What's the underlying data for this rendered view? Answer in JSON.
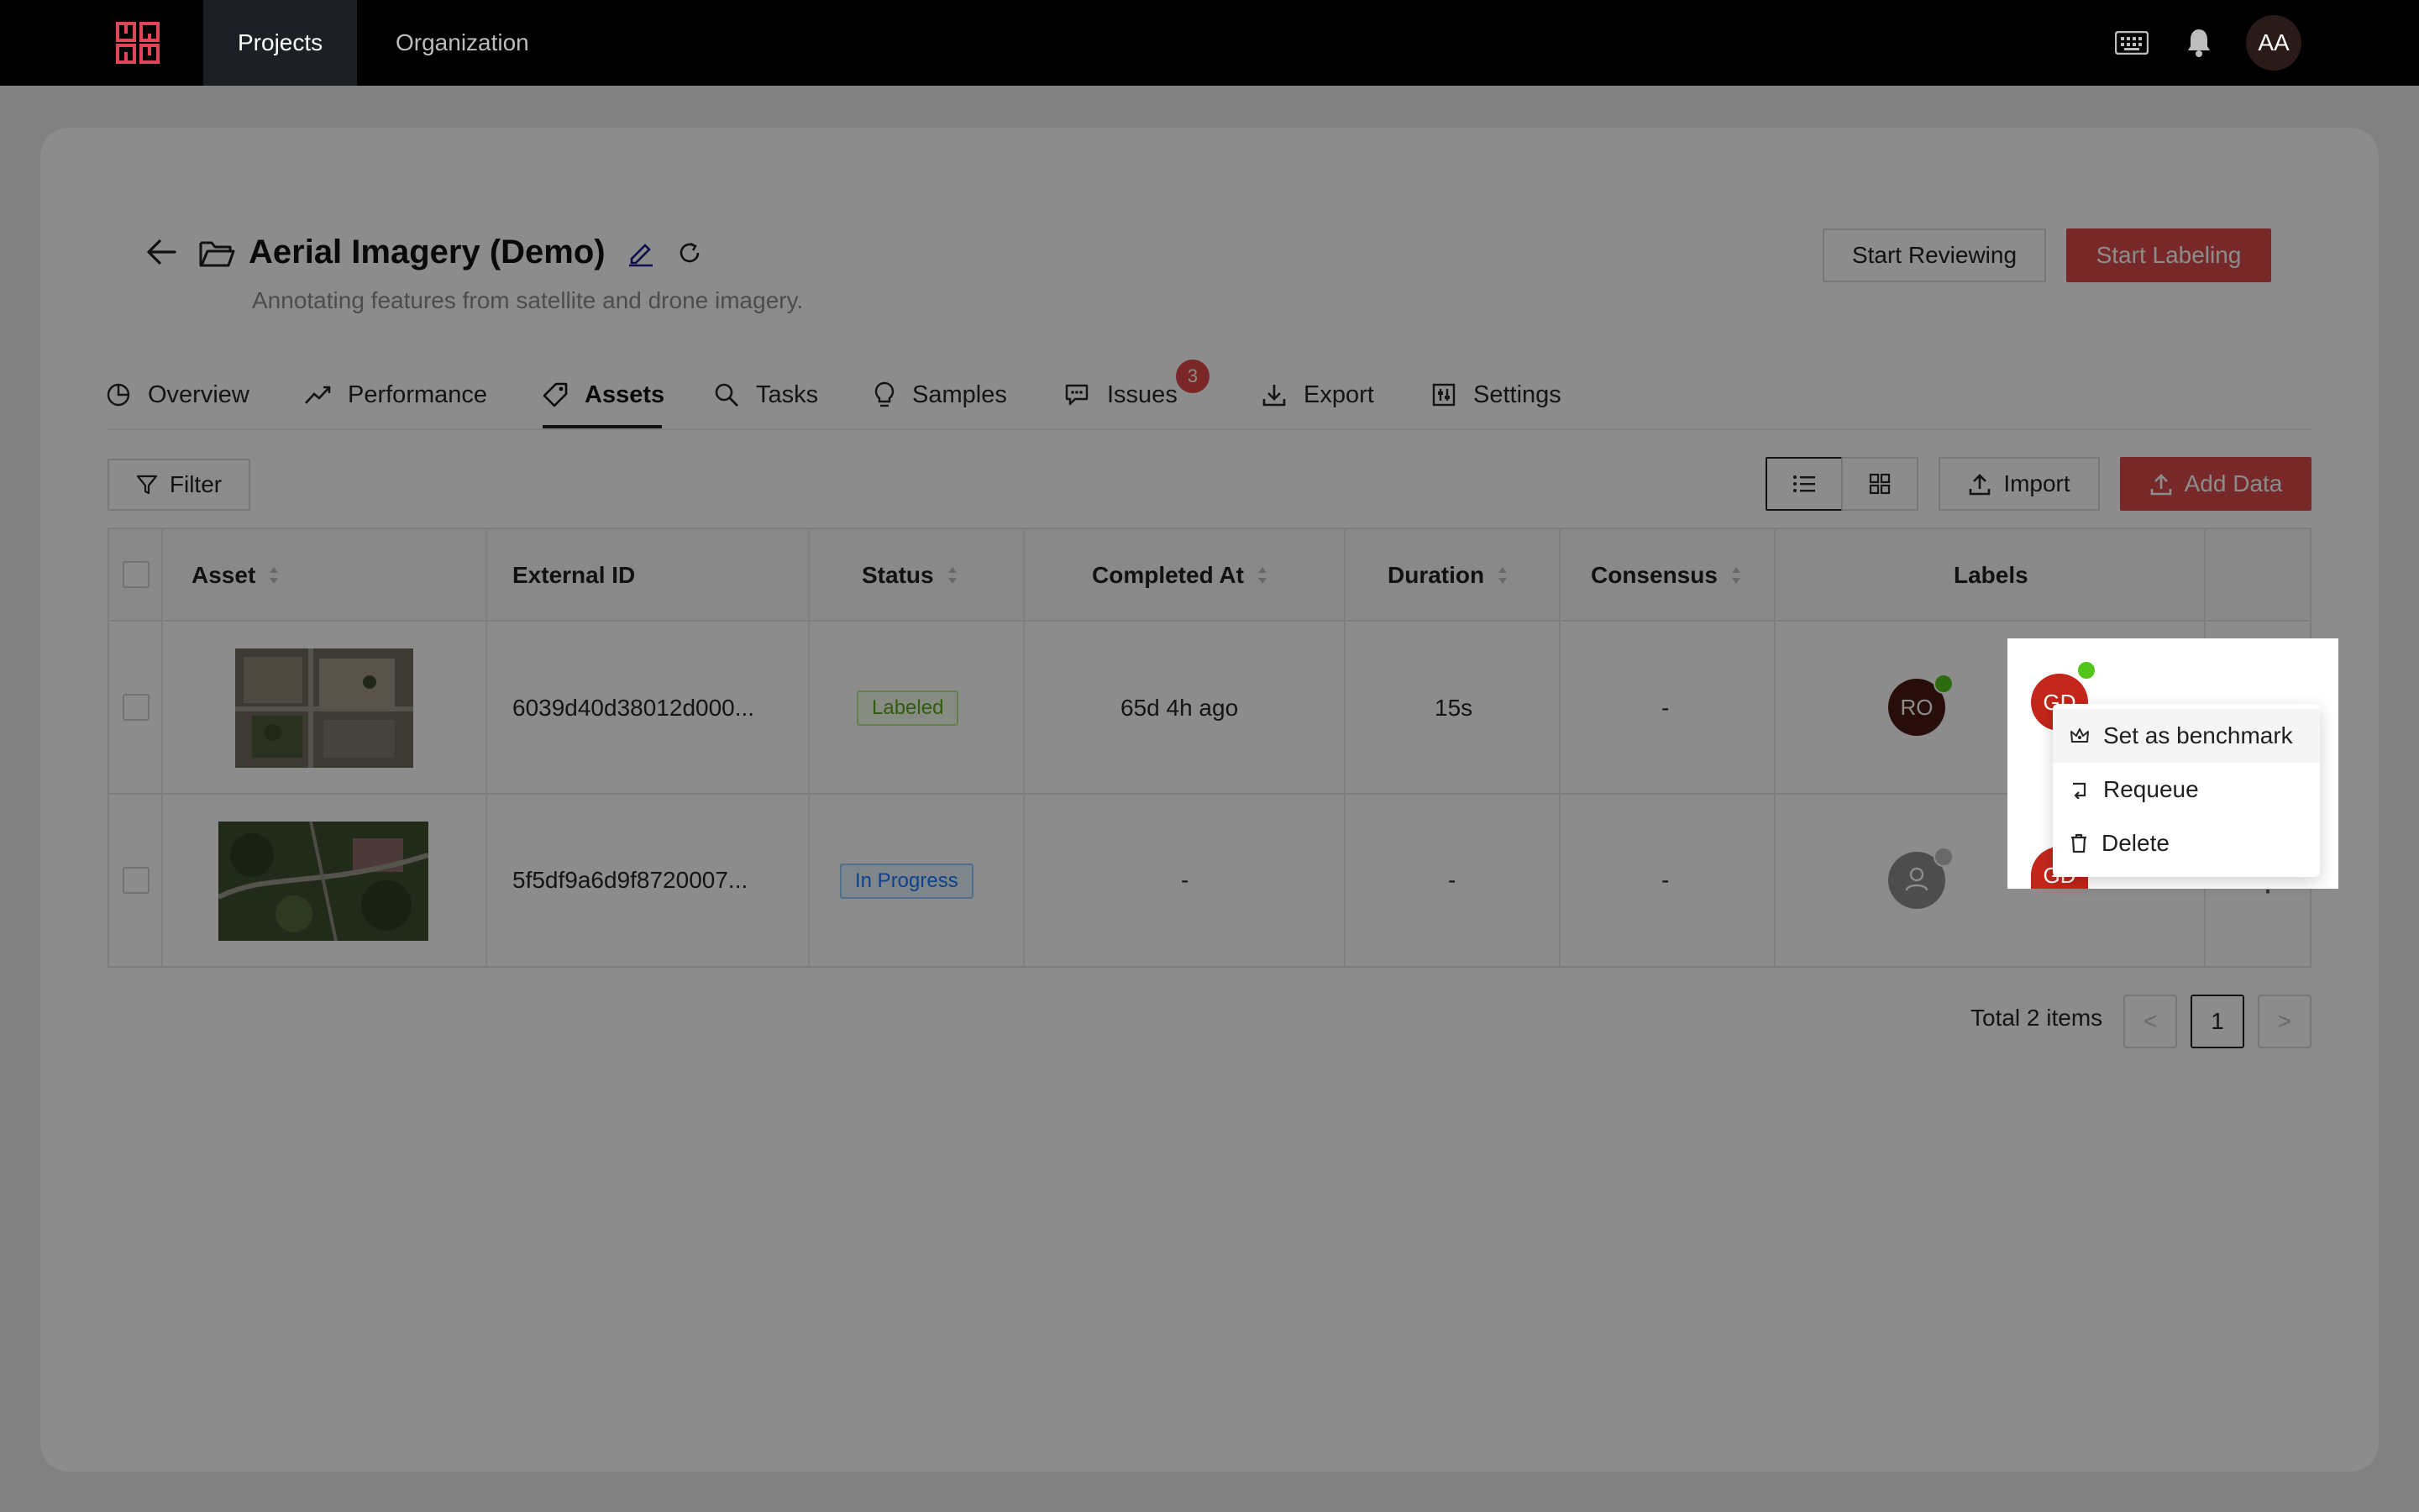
{
  "nav": {
    "tabs": [
      {
        "label": "Projects"
      },
      {
        "label": "Organization"
      }
    ],
    "user_initials": "AA",
    "icons": [
      "app-logo",
      "keyboard-icon",
      "bell-icon"
    ]
  },
  "project": {
    "title": "Aerial Imagery (Demo)",
    "description": "Annotating features from satellite and drone imagery.",
    "start_reviewing_label": "Start Reviewing",
    "start_labeling_label": "Start Labeling"
  },
  "tabs": [
    {
      "label": "Overview",
      "icon": "pie-chart-icon"
    },
    {
      "label": "Performance",
      "icon": "trend-line-icon"
    },
    {
      "label": "Assets",
      "icon": "tag-icon"
    },
    {
      "label": "Tasks",
      "icon": "search-icon"
    },
    {
      "label": "Samples",
      "icon": "bulb-icon"
    },
    {
      "label": "Issues",
      "icon": "chat-icon"
    },
    {
      "label": "Export",
      "icon": "download-icon"
    },
    {
      "label": "Settings",
      "icon": "sliders-icon"
    }
  ],
  "active_tab": "Assets",
  "issues_count": "3",
  "toolbar": {
    "filter_label": "Filter",
    "import_label": "Import",
    "add_data_label": "Add Data"
  },
  "table": {
    "columns": [
      "Asset",
      "External ID",
      "Status",
      "Completed At",
      "Duration",
      "Consensus",
      "Labels"
    ],
    "rows": [
      {
        "external_id": "6039d40d38012d000...",
        "status": "Labeled",
        "completed_at": "65d 4h ago",
        "duration": "15s",
        "consensus": "-",
        "labeler_initials": "RO",
        "reviewer_initials": "GD"
      },
      {
        "external_id": "5f5df9a6d9f8720007...",
        "status": "In Progress",
        "completed_at": "-",
        "duration": "-",
        "consensus": "-",
        "labeler_initials": "",
        "reviewer_initials": "GD"
      }
    ]
  },
  "pagination": {
    "total_text": "Total 2 items",
    "current_page": "1",
    "prev": "<",
    "next": ">"
  },
  "row_menu": {
    "items": [
      {
        "label": "Set as benchmark",
        "icon": "crown-icon"
      },
      {
        "label": "Requeue",
        "icon": "requeue-icon"
      },
      {
        "label": "Delete",
        "icon": "trash-icon"
      }
    ]
  },
  "colors": {
    "accent_red": "#d94b4b",
    "labeled_green": "#5ea61d",
    "in_progress_blue": "#1677ff",
    "nav_bg": "#000000"
  }
}
